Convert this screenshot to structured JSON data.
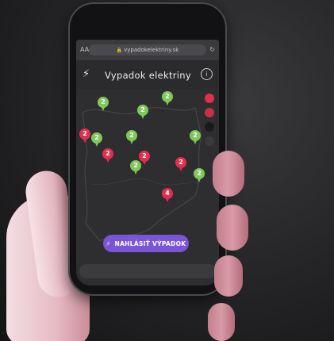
{
  "browser": {
    "url": "vypadokelektriny.sk",
    "lock_glyph": "🔒",
    "left_icon_glyph": "AA",
    "reload_icon_glyph": "↻"
  },
  "app": {
    "title": "Vypadok elektriny",
    "bolt_glyph": "⚡",
    "info_glyph": "i"
  },
  "map_pins": [
    {
      "label": "2",
      "status": "ok"
    },
    {
      "label": "2",
      "status": "ok"
    },
    {
      "label": "2",
      "status": "ok"
    },
    {
      "label": "2",
      "status": "outage"
    },
    {
      "label": "2",
      "status": "ok"
    },
    {
      "label": "2",
      "status": "ok"
    },
    {
      "label": "2",
      "status": "outage"
    },
    {
      "label": "2",
      "status": "outage"
    },
    {
      "label": "2",
      "status": "ok"
    },
    {
      "label": "2",
      "status": "outage"
    },
    {
      "label": "2",
      "status": "ok"
    },
    {
      "label": "4",
      "status": "outage"
    },
    {
      "label": "2",
      "status": "ok"
    }
  ],
  "cta": {
    "label": "NAHLÁSIŤ VÝPADOK",
    "bolt_glyph": "⚡"
  },
  "colors": {
    "ok": "#7fc95a",
    "outage": "#e0304d",
    "accent": "#7b55d6"
  }
}
